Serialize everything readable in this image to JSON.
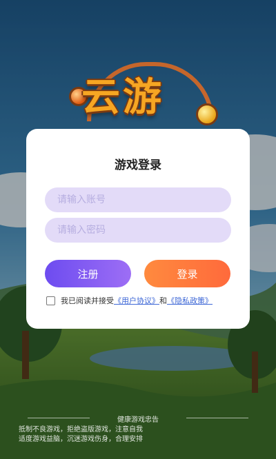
{
  "card": {
    "title": "游戏登录",
    "account_placeholder": "请输入账号",
    "password_placeholder": "请输入密码",
    "register_label": "注册",
    "login_label": "登录"
  },
  "agreement": {
    "prefix": "我已阅读并接受",
    "user_agreement": "《用户协议》",
    "and": "和",
    "privacy_policy": "《隐私政策》"
  },
  "logo": {
    "text": "云游"
  },
  "footer": {
    "title": "健康游戏忠告",
    "line1": "抵制不良游戏，拒绝盗版游戏，注意自我",
    "line2": "适度游戏益脑，沉迷游戏伤身，合理安排"
  },
  "colors": {
    "accent_purple": "#7b55f2",
    "accent_orange": "#ff7a3d",
    "input_bg": "#e3dbf8",
    "link": "#3c66d6"
  }
}
